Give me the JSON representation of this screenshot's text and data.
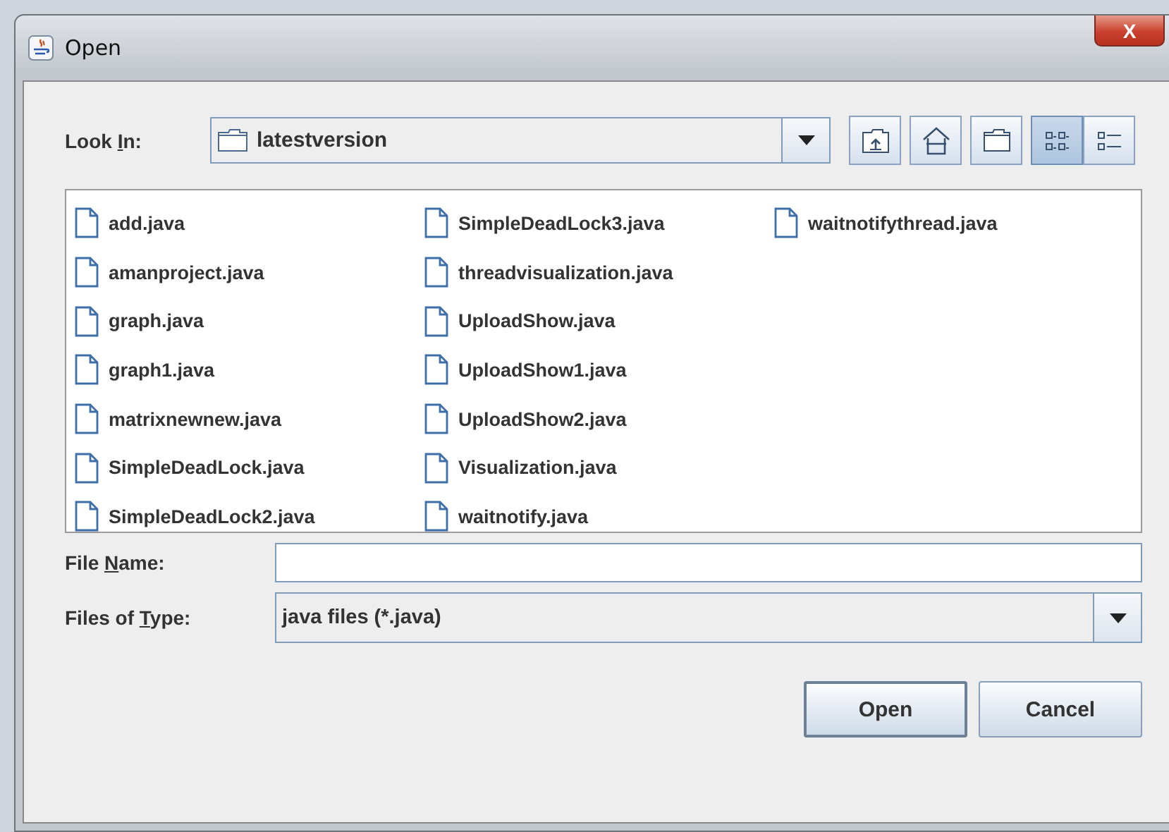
{
  "window": {
    "title": "Open",
    "close_label": "X"
  },
  "look_in": {
    "label_parts": {
      "before": "Look ",
      "key": "I",
      "after": "n:"
    },
    "value": "latestversion"
  },
  "view_buttons": [
    {
      "kind": "list",
      "selected": true
    },
    {
      "kind": "details",
      "selected": false
    }
  ],
  "files": [
    {
      "name": "add.java"
    },
    {
      "name": "amanproject.java"
    },
    {
      "name": "graph.java"
    },
    {
      "name": "graph1.java"
    },
    {
      "name": "matrixnewnew.java"
    },
    {
      "name": "SimpleDeadLock.java"
    },
    {
      "name": "SimpleDeadLock2.java"
    },
    {
      "name": "SimpleDeadLock3.java"
    },
    {
      "name": "threadvisualization.java"
    },
    {
      "name": "UploadShow.java"
    },
    {
      "name": "UploadShow1.java"
    },
    {
      "name": "UploadShow2.java"
    },
    {
      "name": "Visualization.java"
    },
    {
      "name": "waitnotify.java"
    },
    {
      "name": "waitnotifythread.java"
    }
  ],
  "file_name": {
    "label_parts": {
      "before": "File ",
      "key": "N",
      "after": "ame:"
    }
  },
  "file_type": {
    "label_parts": {
      "before": "Files of ",
      "key": "T",
      "after": "ype:"
    },
    "value": "java files (*.java)"
  },
  "buttons": [
    {
      "label": "Open",
      "kind": "default"
    },
    {
      "label": "Cancel",
      "kind": "normal"
    }
  ]
}
